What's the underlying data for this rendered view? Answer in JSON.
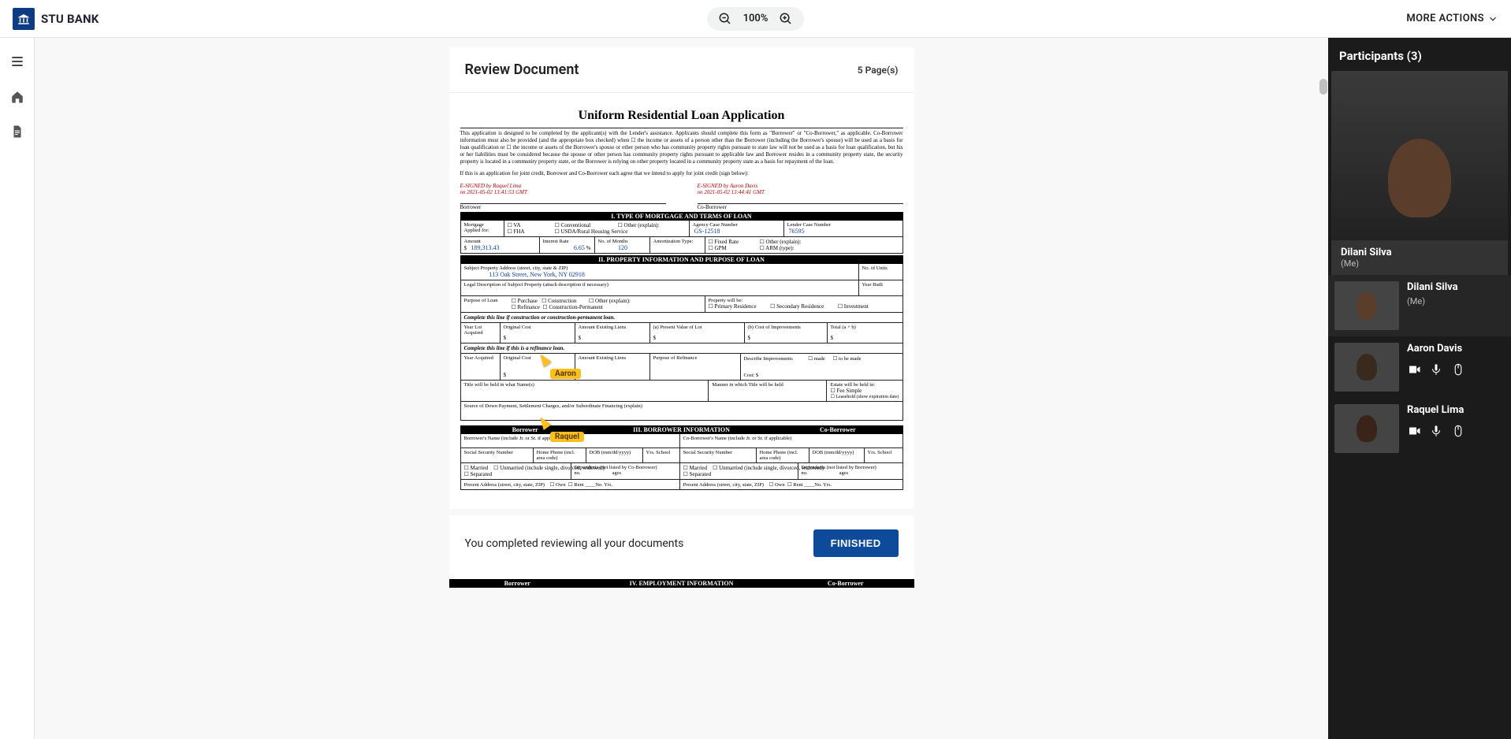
{
  "brand": {
    "name": "STU BANK"
  },
  "zoom": {
    "level": "100%"
  },
  "more_actions": "MORE ACTIONS",
  "doc": {
    "title": "Review Document",
    "page_count": "5 Page(s)",
    "form_title": "Uniform Residential Loan Application",
    "intro": "This application is designed to be completed by the applicant(s) with the Lender's assistance. Applicants should complete this form as \"Borrower\" or \"Co-Borrower,\" as applicable. Co-Borrower information must also be provided (and the appropriate box checked) when ☐ the income or assets of a person other than the Borrower (including the Borrower's spouse) will be used as a basis for loan qualification or ☐ the income or assets of the Borrower's spouse or other person who has community property rights pursuant to state law will not be used as a basis for loan qualification, but his or her liabilities must be considered because the spouse or other person has community property rights pursuant to applicable law and Borrower resides in a community property state, the security property is located in a community property state, or the Borrower is relying on other property located in a community property state as a basis for repayment of the loan.",
    "joint": "If this is an application for joint credit, Borrower and Co-Borrower each agree that we intend to apply for joint credit (sign below):",
    "sig": {
      "borrower_sig": "E-SIGNED by Raquel Lima",
      "borrower_sig2": "on 2021-05-02 13:41:53 GMT",
      "borrower_label": "Borrower",
      "coborrower_sig": "E-SIGNED by Aaron Davis",
      "coborrower_sig2": "on 2021-05-02 13:44:41 GMT",
      "coborrower_label": "Co-Borrower"
    },
    "sections": {
      "s1": "I. TYPE OF MORTGAGE AND TERMS OF LOAN",
      "s2": "II. PROPERTY INFORMATION AND PURPOSE OF LOAN",
      "s3_borrower": "Borrower",
      "s3": "III. BORROWER INFORMATION",
      "s3_coborrower": "Co-Borrower",
      "s4_borrower": "Borrower",
      "s4": "IV. EMPLOYMENT INFORMATION",
      "s4_coborrower": "Co-Borrower"
    },
    "fields": {
      "mortgage_label": "Mortgage Applied for:",
      "va": "VA",
      "fha": "FHA",
      "conv": "Conventional",
      "usda": "USDA/Rural Housing Service",
      "other": "Other (explain):",
      "agency_label": "Agency Case Number",
      "agency_val": "GS-12518",
      "lender_label": "Lender Case Number",
      "lender_val": "76595",
      "amount_label": "Amount",
      "amount_val": "189,313.43",
      "rate_label": "Interest Rate",
      "rate_val": "6.65",
      "pct": "%",
      "months_label": "No. of Months",
      "months_val": "120",
      "amort_label": "Amortization Type:",
      "fixed": "Fixed Rate",
      "gpm": "GPM",
      "other2": "Other (explain):",
      "arm": "ARM (type):",
      "prop_addr": "Subject Property Address (street, city, state & ZIP)",
      "prop_val": "113 Oak Street, New York, NY 02918",
      "units": "No. of Units",
      "legal_desc": "Legal Description of Subject Property (attach description if necessary)",
      "year_built": "Year Built",
      "purpose": "Purpose of Loan",
      "purchase": "Purchase",
      "construction": "Construction",
      "other3": "Other (explain):",
      "refinance": "Refinance",
      "consperm": "Construction-Permanent",
      "prop_will": "Property will be:",
      "primary": "Primary Residence",
      "secondary": "Secondary Residence",
      "investment": "Investment",
      "construction_line": "Complete this line if construction or construction-permanent loan.",
      "year_lot": "Year Lot Acquired",
      "orig_cost": "Original Cost",
      "exist_liens": "Amount Existing Liens",
      "present_val": "(a) Present Value of Lot",
      "cost_imp": "(b) Cost of Improvements",
      "total": "Total (a + b)",
      "dollar": "$",
      "refinance_line": "Complete this line if this is a refinance loan.",
      "year_acq": "Year Acquired",
      "purpose_ref": "Purpose of Refinance",
      "desc_imp": "Describe Improvements",
      "made": "made",
      "tobe": "to be made",
      "cost_label": "Cost: $",
      "title_held": "Title will be held in what Name(s)",
      "manner": "Manner in which Title will be held",
      "estate": "Estate will be held in:",
      "fee": "Fee Simple",
      "leasehold": "Leasehold (show expiration date)",
      "source": "Source of Down Payment, Settlement Charges, and/or Subordinate Financing (explain)",
      "borrower_name": "Borrower's Name (include Jr. or Sr. if applicable)",
      "coborrower_name": "Co-Borrower's Name (include Jr. or Sr. if applicable)",
      "ssn": "Social Security Number",
      "home_phone": "Home Phone (incl. area code)",
      "dob": "DOB (mm/dd/yyyy)",
      "yrs": "Yrs. School",
      "married": "Married",
      "unmarried": "Unmarried (include single, divorced, widowed)",
      "separated": "Separated",
      "dep": "Dependents (not listed by Co-Borrower)",
      "dep2": "Dependents (not listed by Borrower)",
      "no": "no.",
      "ages": "ages",
      "present_addr": "Present Address (street, city, state, ZIP)",
      "own": "Own",
      "rent": "Rent",
      "noyrs": "____No. Yrs."
    }
  },
  "footer": {
    "message": "You completed reviewing all your documents",
    "button": "FINISHED"
  },
  "remote_cursors": {
    "aaron": "Aaron",
    "raquel": "Raquel"
  },
  "participants": {
    "header": "Participants (3)",
    "main": {
      "name": "Dilani Silva",
      "me": "(Me)"
    },
    "list": [
      {
        "name": "Dilani Silva",
        "me": "(Me)"
      },
      {
        "name": "Aaron Davis"
      },
      {
        "name": "Raquel Lima"
      }
    ]
  }
}
